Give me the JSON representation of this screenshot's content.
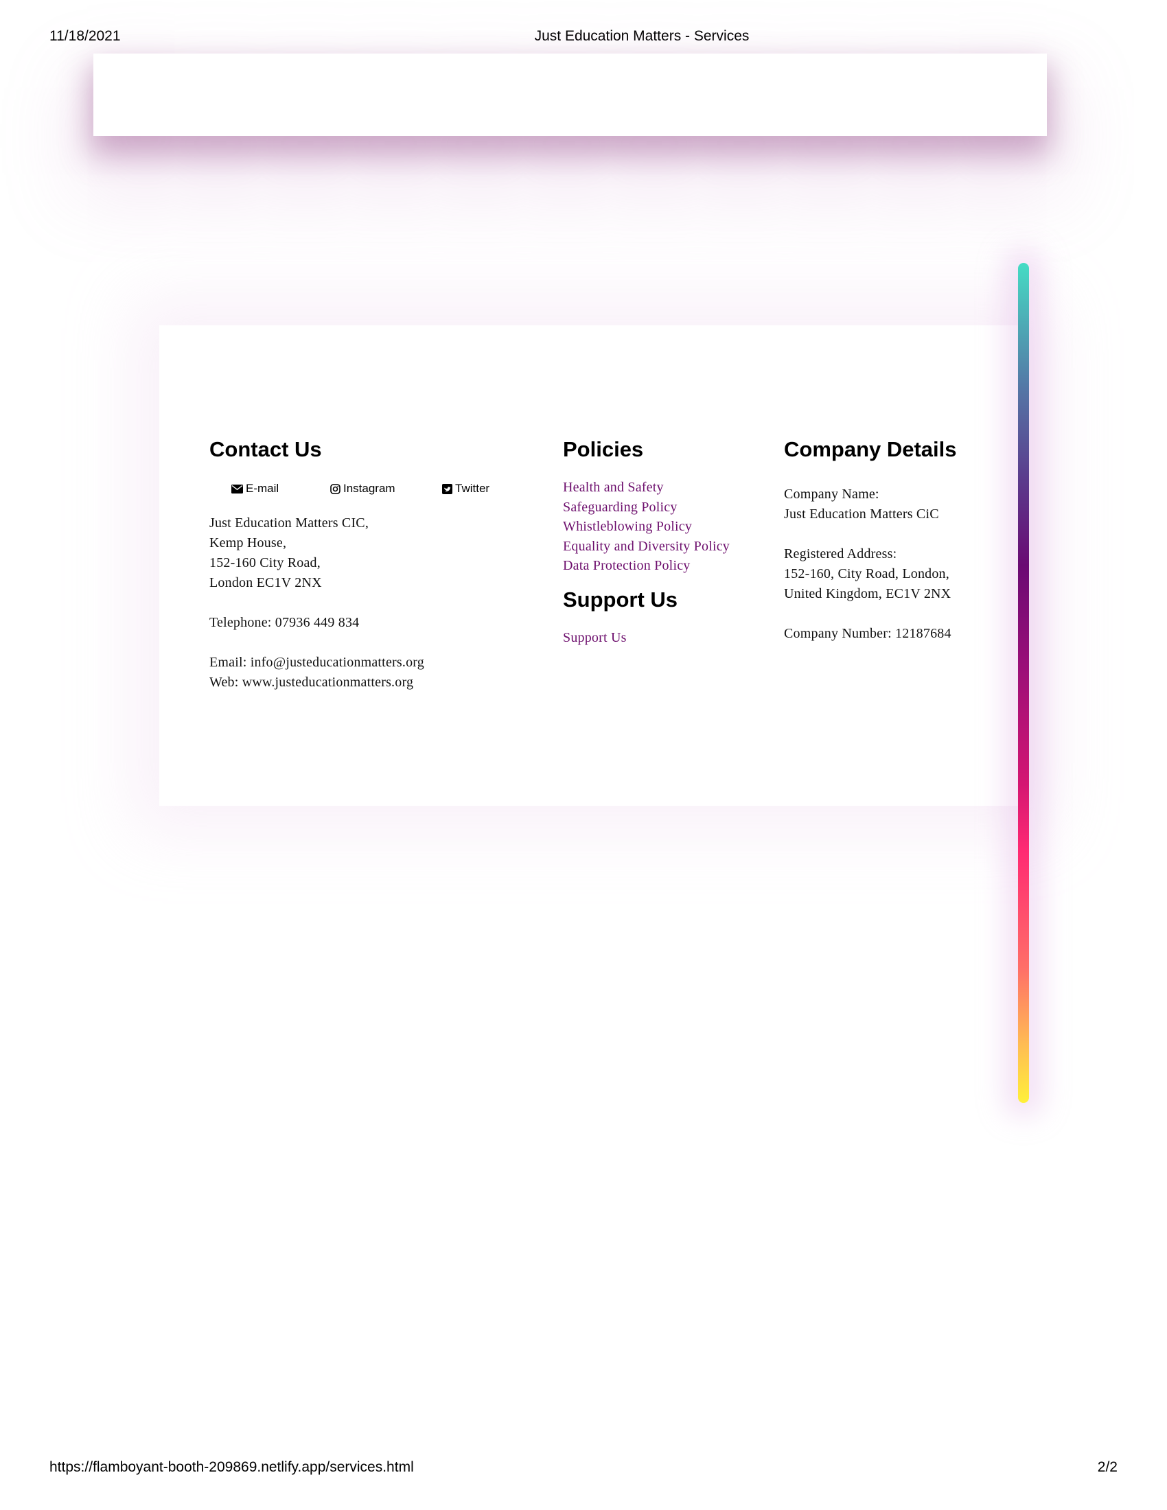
{
  "print_header": {
    "date": "11/18/2021",
    "title": "Just Education Matters - Services"
  },
  "print_footer": {
    "url": "https://flamboyant-booth-209869.netlify.app/services.html",
    "page": "2/2"
  },
  "contact": {
    "heading": "Contact Us",
    "social": {
      "email_label": "E-mail",
      "instagram_label": "Instagram",
      "twitter_label": "Twitter"
    },
    "address": [
      "Just Education Matters CIC,",
      "Kemp House,",
      "152-160 City Road,",
      "London EC1V 2NX"
    ],
    "telephone": "Telephone: 07936 449 834",
    "email": "Email: info@justeducationmatters.org",
    "web": "Web: www.justeducationmatters.org"
  },
  "policies": {
    "heading": "Policies",
    "items": [
      "Health and Safety",
      "Safeguarding Policy",
      "Whistleblowing Policy",
      "Equality and Diversity Policy",
      "Data Protection Policy"
    ]
  },
  "support": {
    "heading": "Support Us",
    "link_label": "Support Us"
  },
  "company": {
    "heading": "Company Details",
    "name_label": "Company Name:",
    "name_value": "Just Education Matters CiC",
    "address_label": "Registered Address:",
    "address_line1": "152-160, City Road, London,",
    "address_line2": "United Kingdom, EC1V 2NX",
    "number": "Company Number: 12187684"
  },
  "colors": {
    "link": "#6d0f6d",
    "gradient_top": "#45dcc4",
    "gradient_mid": "#6a0a73",
    "gradient_pink": "#ff2a72",
    "gradient_bottom": "#fff03a"
  },
  "icons": [
    "envelope-icon",
    "instagram-icon",
    "twitter-icon"
  ]
}
